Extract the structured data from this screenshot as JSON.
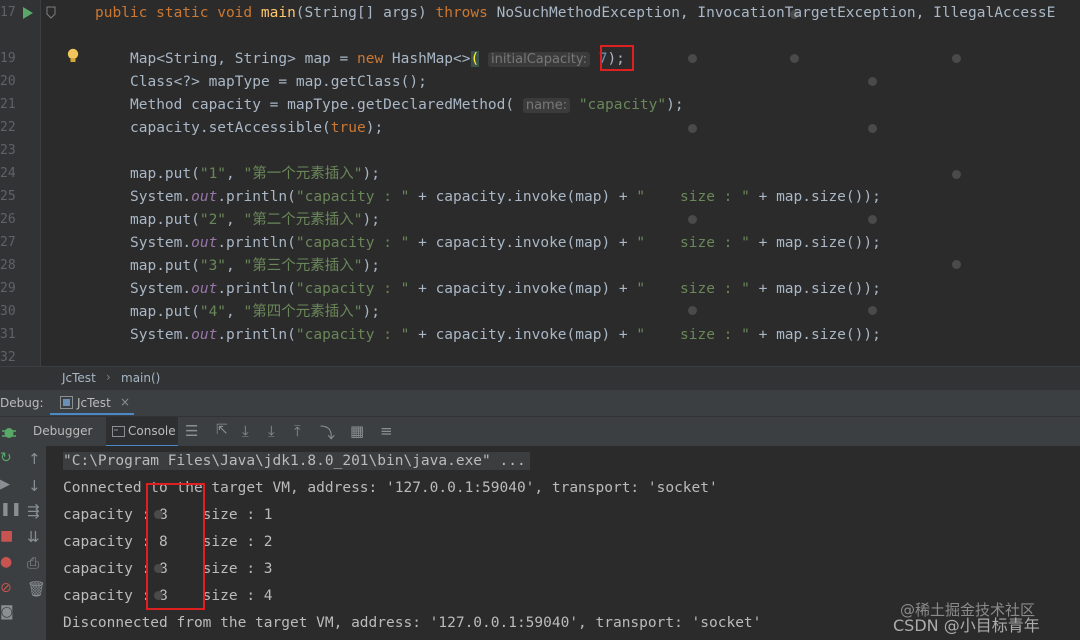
{
  "editor": {
    "line_numbers": [
      "17",
      "19",
      "20",
      "21",
      "22",
      "23",
      "24",
      "25",
      "26",
      "27",
      "28",
      "29",
      "30",
      "31",
      "32"
    ],
    "signature": {
      "pre": "public static void ",
      "name": "main",
      "args": "(String[] args) ",
      "throws_kw": "throws",
      "exceptions": " NoSuchMethodException, InvocationTargetException, IllegalAccessE"
    },
    "line19": {
      "pre": "Map<String, String> map = ",
      "new_kw": "new",
      "post": " HashMap<>",
      "paren": "(",
      "hint": "initialCapacity:",
      "value": "7",
      "end": ");"
    },
    "line20": "Class<?> mapType = map.getClass();",
    "line21": {
      "pre": "Method capacity = mapType.getDeclaredMethod(",
      "hint": "name:",
      "str": "\"capacity\"",
      "end": ");"
    },
    "line22": {
      "pre": "capacity.setAccessible(",
      "kw": "true",
      "end": ");"
    },
    "puts": [
      {
        "pre": "map.put(",
        "k": "\"1\"",
        "sep": ", ",
        "v": "\"第一个元素插入\"",
        "end": ");"
      },
      {
        "pre": "map.put(",
        "k": "\"2\"",
        "sep": ", ",
        "v": "\"第二个元素插入\"",
        "end": ");"
      },
      {
        "pre": "map.put(",
        "k": "\"3\"",
        "sep": ", ",
        "v": "\"第三个元素插入\"",
        "end": ");"
      },
      {
        "pre": "map.put(",
        "k": "\"4\"",
        "sep": ", ",
        "v": "\"第四个元素插入\"",
        "end": ");"
      }
    ],
    "println": {
      "sys": "System.",
      "out": "out",
      "call": ".println(",
      "s1": "\"capacity : \"",
      "mid": " + capacity.invoke(map) + ",
      "s2": "\"    size : \"",
      "tail": " + map.size());"
    }
  },
  "breadcrumb": {
    "class": "JcTest",
    "method": "main()"
  },
  "debug": {
    "label": "Debug:",
    "tab": "JcTest",
    "close": "×"
  },
  "tabs": {
    "debugger": "Debugger",
    "console": "Console"
  },
  "console": {
    "lines": [
      "\"C:\\Program Files\\Java\\jdk1.8.0_201\\bin\\java.exe\" ...",
      "Connected to the target VM, address: '127.0.0.1:59040', transport: 'socket'",
      "capacity : 8    size : 1",
      "capacity : 8    size : 2",
      "capacity : 8    size : 3",
      "capacity : 8    size : 4",
      "Disconnected from the target VM, address: '127.0.0.1:59040', transport: 'socket'"
    ]
  },
  "watermark": {
    "line1": "@稀土掘金技术社区",
    "line2": "CSDN @小目标青年"
  },
  "colors": {
    "keyword": "#cc7832",
    "string": "#6a8759",
    "field": "#9876aa",
    "highlight_box": "#e02020",
    "run_icon": "#59a869"
  }
}
